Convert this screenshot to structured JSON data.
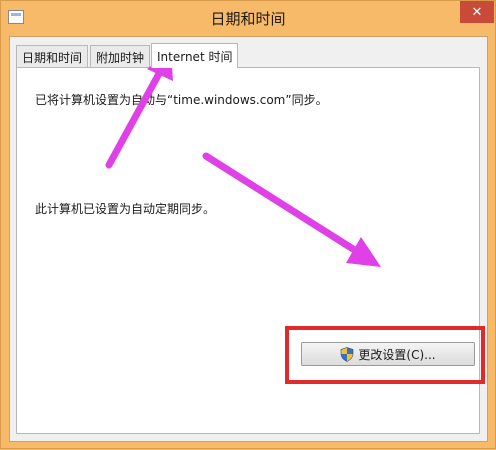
{
  "window": {
    "title": "日期和时间",
    "close_glyph": "✕"
  },
  "tabs": [
    {
      "label": "日期和时间",
      "active": false
    },
    {
      "label": "附加时钟",
      "active": false
    },
    {
      "label": "Internet 时间",
      "active": true
    }
  ],
  "panel": {
    "sync_server_text": "已将计算机设置为自动与“time.windows.com”同步。",
    "auto_sync_text": "此计算机已设置为自动定期同步。",
    "change_button_label": "更改设置(C)..."
  },
  "icons": {
    "app": "calendar-icon",
    "button": "uac-shield-icon"
  },
  "annotation_colors": {
    "arrow": "#e040e8",
    "highlight_box": "#e02b2b"
  }
}
